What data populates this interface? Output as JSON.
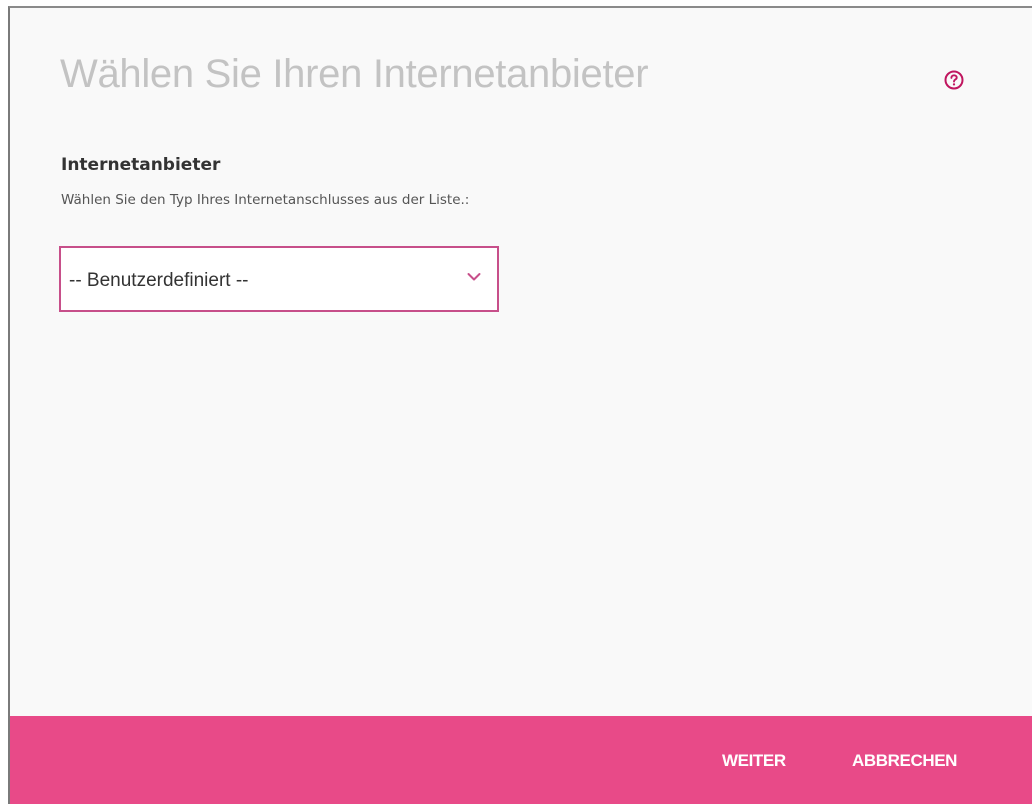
{
  "dialog": {
    "title": "Wählen Sie Ihren Internetanbieter",
    "help_icon": "help-circle-icon"
  },
  "provider_field": {
    "label": "Internetanbieter",
    "description": "Wählen Sie den Typ Ihres Internetanschlusses aus der Liste.:",
    "selected_value": "-- Benutzerdefiniert --",
    "dropdown_icon": "chevron-down-icon"
  },
  "footer": {
    "next_label": "WEITER",
    "cancel_label": "ABBRECHEN"
  },
  "colors": {
    "accent": "#e84a88",
    "select_border": "#c74f8a",
    "title_text": "#c3c3c3",
    "background": "#f9f9f9"
  }
}
